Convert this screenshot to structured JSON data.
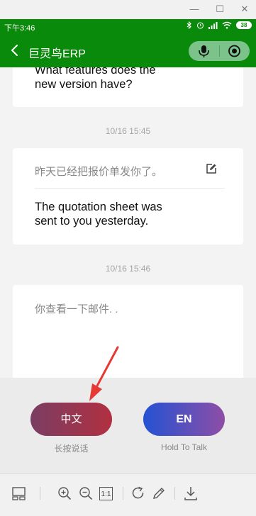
{
  "window": {
    "minimize_label": "—",
    "maximize_label": "☐",
    "close_label": "✕"
  },
  "status_bar": {
    "time": "下午3:46",
    "battery": "38"
  },
  "header": {
    "title": "巨灵鸟ERP"
  },
  "messages": [
    {
      "english": "What features does the new version have?"
    },
    {
      "timestamp": "10/16 15:45",
      "chinese": "昨天已经把报价单发你了。",
      "english_line1": "The quotation sheet was",
      "english_line2": "sent to you yesterday."
    },
    {
      "timestamp": "10/16 15:46",
      "chinese": "你查看一下邮件. ."
    }
  ],
  "message_1_line1": "What features does the",
  "message_1_line2": "new version have?",
  "talk": {
    "zh_button": "中文",
    "zh_hint": "长按说话",
    "en_button": "EN",
    "en_hint": "Hold To Talk"
  },
  "colors": {
    "status_green": "#0a8a0a",
    "zh_button_start": "#7a3d62",
    "zh_button_end": "#b13040",
    "en_button_start": "#2452d3",
    "en_button_end": "#8e4ea6",
    "annotation_arrow": "#e53935"
  },
  "toolbar_icons": [
    "panel-icon",
    "zoom-in-icon",
    "zoom-out-icon",
    "actual-size-icon",
    "rotate-icon",
    "pen-icon",
    "download-icon"
  ],
  "toolbar": {
    "actual_size_label": "1:1"
  }
}
